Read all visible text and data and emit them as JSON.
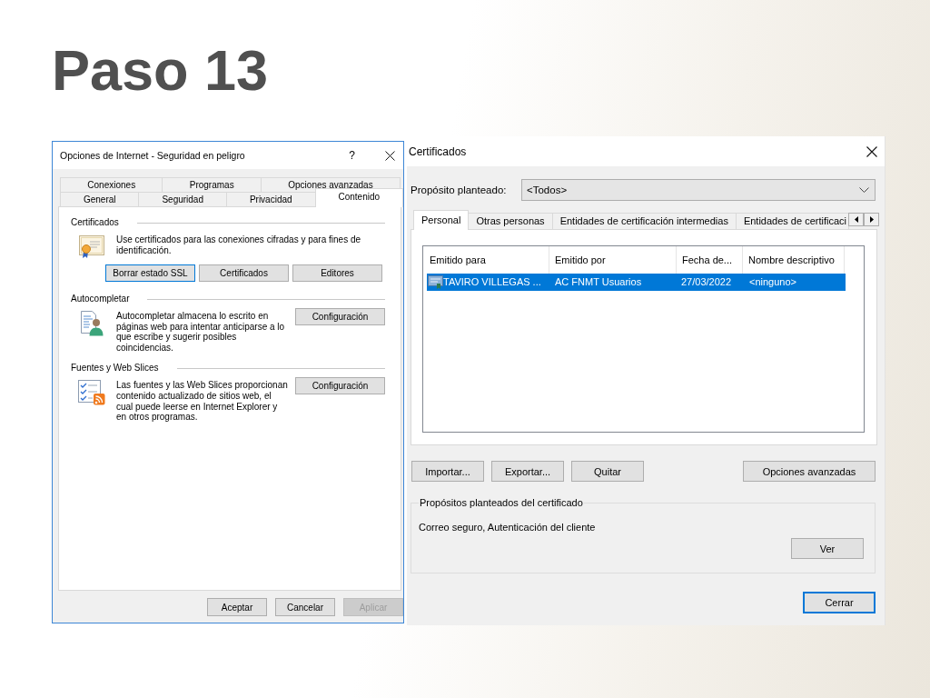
{
  "slide": {
    "title": "Paso 13"
  },
  "internet_options": {
    "window": {
      "title": "Opciones de Internet - Seguridad en peligro",
      "help": "?"
    },
    "tab_rows": [
      [
        {
          "label": "Conexiones",
          "selected": false
        },
        {
          "label": "Programas",
          "selected": false
        },
        {
          "label": "Opciones avanzadas",
          "selected": false
        }
      ],
      [
        {
          "label": "General",
          "selected": false
        },
        {
          "label": "Seguridad",
          "selected": false
        },
        {
          "label": "Privacidad",
          "selected": false
        },
        {
          "label": "Contenido",
          "selected": true
        }
      ]
    ],
    "sections": [
      {
        "kind": "certificates",
        "title": "Certificados",
        "description": "Use certificados para las conexiones cifradas y para fines de identificación.",
        "buttons": [
          {
            "label": "Borrar estado SSL",
            "focused": true
          },
          {
            "label": "Certificados",
            "focused": false
          },
          {
            "label": "Editores",
            "focused": false
          }
        ]
      },
      {
        "kind": "autocomplete",
        "title": "Autocompletar",
        "description": "Autocompletar almacena lo escrito en páginas web para intentar anticiparse a lo que escribe y sugerir posibles coincidencias.",
        "buttons": [
          {
            "label": "Configuración",
            "focused": false
          }
        ]
      },
      {
        "kind": "feeds",
        "title": "Fuentes y Web Slices",
        "description": "Las fuentes y las Web Slices proporcionan contenido actualizado de sitios web, el cual puede leerse en Internet Explorer y en otros programas.",
        "buttons": [
          {
            "label": "Configuración",
            "focused": false
          }
        ]
      }
    ],
    "footer_buttons": [
      {
        "label": "Aceptar",
        "disabled": false
      },
      {
        "label": "Cancelar",
        "disabled": false
      },
      {
        "label": "Aplicar",
        "disabled": true
      }
    ]
  },
  "certificates": {
    "window": {
      "title": "Certificados"
    },
    "purpose": {
      "label": "Propósito planteado:",
      "value": "<Todos>"
    },
    "tabs": [
      {
        "label": "Personal",
        "selected": true
      },
      {
        "label": "Otras personas",
        "selected": false
      },
      {
        "label": "Entidades de certificación intermedias",
        "selected": false
      },
      {
        "label": "Entidades de certificaci",
        "selected": false
      }
    ],
    "table": {
      "columns": [
        "Emitido para",
        "Emitido por",
        "Fecha de...",
        "Nombre descriptivo"
      ],
      "rows": [
        {
          "selected": true,
          "cells": [
            "TAVIRO VILLEGAS ...",
            "AC FNMT Usuarios",
            "27/03/2022",
            "<ninguno>"
          ]
        }
      ]
    },
    "actions": [
      "Importar...",
      "Exportar...",
      "Quitar",
      "Opciones avanzadas"
    ],
    "purposes": {
      "title": "Propósitos planteados del certificado",
      "text": "Correo seguro, Autenticación del cliente",
      "button": "Ver"
    },
    "close_button": {
      "label": "Cerrar",
      "default": true
    }
  }
}
